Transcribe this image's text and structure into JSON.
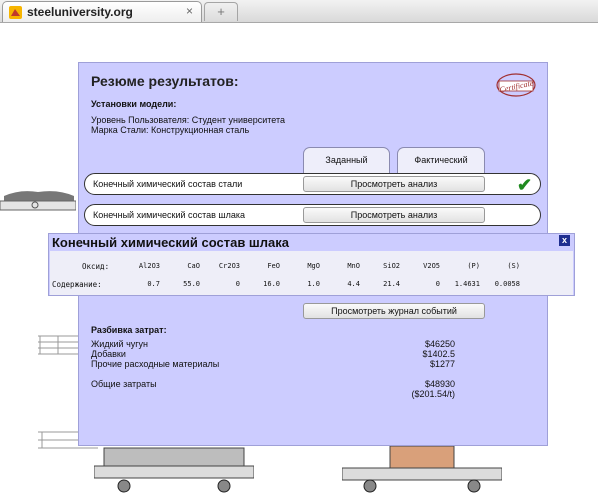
{
  "browser": {
    "tab_title": "steeluniversity.org",
    "tab_close": "×",
    "new_tab": "+"
  },
  "panel": {
    "title": "Резюме результатов:",
    "certificate_text": "Certificate",
    "setup_heading": "Установки модели:",
    "user_level": "Уровень Пользователя: Студент университета",
    "steel_grade": "Марка Стали: Конструкционная сталь",
    "col_target": "Заданный",
    "col_actual": "Фактический",
    "rows": [
      {
        "label": "Конечный химический состав стали",
        "button": "Просмотреть анализ",
        "ok": "✔"
      },
      {
        "label": "Конечный химический состав шлака",
        "button": "Просмотреть анализ"
      }
    ],
    "log_button": "Просмотреть журнал событий",
    "costs": {
      "heading": "Разбивка затрат:",
      "items": [
        {
          "label": "Жидкий чугун",
          "value": "$46250"
        },
        {
          "label": "Добавки",
          "value": "$1402.5"
        },
        {
          "label": "Прочие расходные материалы",
          "value": "$1277"
        }
      ],
      "total_label": "Общие затраты",
      "total_value": "$48930",
      "per_tonne": "($201.54/t)"
    }
  },
  "slag_popup": {
    "title": "Конечный химический состав шлака",
    "close": "x",
    "oxide_label": "Оксид:",
    "content_label": "Содержание:",
    "oxides": [
      "Al2O3",
      "CaO",
      "Cr2O3",
      "FeO",
      "MgO",
      "MnO",
      "SiO2",
      "V2O5",
      "(P)",
      "(S)"
    ],
    "values": [
      "0.7",
      "55.0",
      "0",
      "16.0",
      "1.0",
      "4.4",
      "21.4",
      "0",
      "1.4631",
      "0.0058"
    ]
  },
  "colors": {
    "panel_bg": "#ccccff",
    "popup_header_bg": "#ccccff",
    "popup_body_bg": "#eeeef8",
    "check_green": "#1f8a1f"
  }
}
